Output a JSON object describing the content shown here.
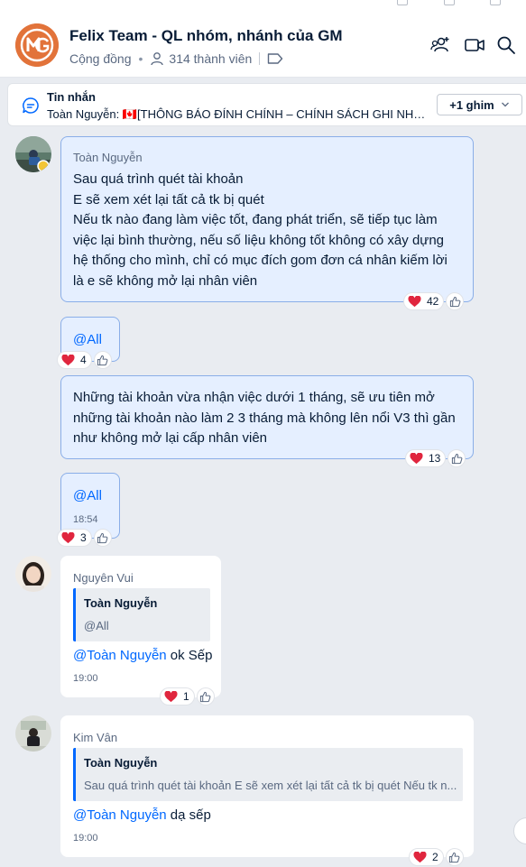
{
  "header": {
    "title": "Felix Team - QL nhóm, nhánh của GM",
    "category": "Cộng đồng",
    "members": "314 thành viên",
    "brand_color": "#e2733a"
  },
  "pinned": {
    "title": "Tin nhắn",
    "text": "Toàn Nguyễn: 🇨🇦[THÔNG BÁO ĐÍNH CHÍNH – CHÍNH SÁCH GHI NHẬ...",
    "more_label": "+1 ghim"
  },
  "messages": [
    {
      "sender": "Toàn Nguyễn",
      "lines": [
        "Sau quá trình quét tài khoản",
        "E sẽ xem xét lại tất cả tk bị quét",
        "Nếu tk nào đang làm việc tốt, đang phát triển, sẽ tiếp tục làm",
        "việc lại bình thường, nếu số liệu không tốt không có xây dựng",
        "hệ thống cho mình, chỉ có mục đích gom đơn cá nhân kiếm lời",
        "là e sẽ không mở lại nhân viên"
      ],
      "reactions": "42"
    },
    {
      "text": "@All",
      "reactions": "4"
    },
    {
      "lines": [
        "Những tài khoản vừa nhận việc dưới 1 tháng, sẽ ưu tiên mở",
        "những tài khoản nào làm 2 3  tháng mà không lên nổi V3 thì gần",
        "như không mở lại cấp nhân viên"
      ],
      "reactions": "13"
    },
    {
      "text": "@All",
      "time": "18:54",
      "reactions": "3"
    },
    {
      "sender": "Nguyên Vui",
      "quote_name": "Toàn Nguyễn",
      "quote_text": "@All",
      "mention": "@Toàn Nguyễn",
      "text": " ok Sếp",
      "time": "19:00",
      "reactions": "1"
    },
    {
      "sender": "Kim Vân",
      "quote_name": "Toàn Nguyễn",
      "quote_text": "Sau quá trình quét tài khoản E sẽ xem xét lại tất cả tk bị quét Nếu tk n...",
      "mention": "@Toàn Nguyễn",
      "text": " dạ sếp",
      "time": "19:00",
      "reactions": "2"
    }
  ],
  "colors": {
    "accent": "#0068ff",
    "own_bubble": "#e5efff",
    "heart": "#e0263e"
  },
  "icons": [
    "add-member-icon",
    "video-call-icon",
    "search-icon",
    "chat-bubble-icon",
    "heart-icon",
    "like-icon",
    "tag-icon",
    "person-icon"
  ]
}
